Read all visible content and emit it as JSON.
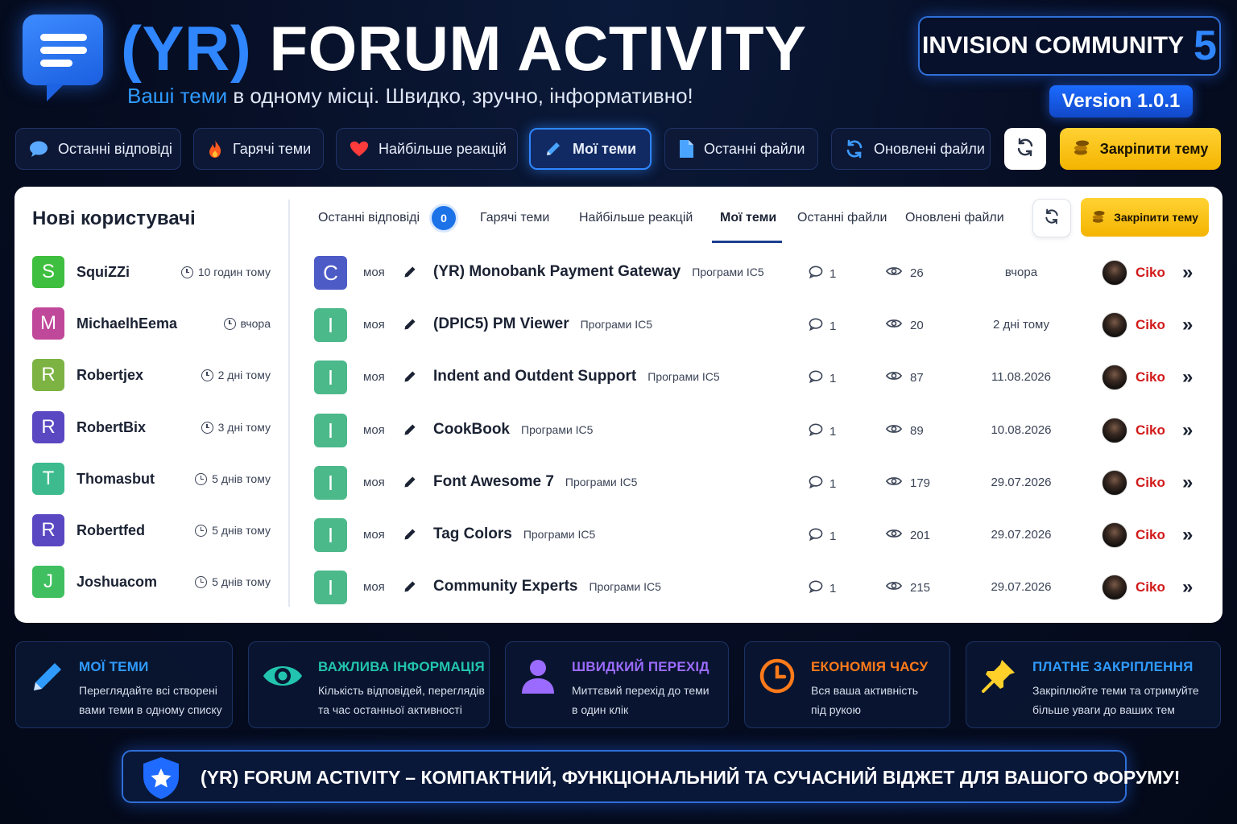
{
  "header": {
    "title_accent": "(YR)",
    "title_main": "FORUM ACTIVITY",
    "subtitle_accent": "Ваші теми",
    "subtitle_rest": "в одному місці. Швидко, зручно, інформативно!",
    "platform": "INVISION COMMUNITY",
    "platform_version": "5",
    "version": "Version 1.0.1"
  },
  "top_tabs": [
    {
      "label": "Останні відповіді",
      "icon": "speech-bubble-icon"
    },
    {
      "label": "Гарячі теми",
      "icon": "fire-icon"
    },
    {
      "label": "Найбільше реакцій",
      "icon": "heart-icon"
    },
    {
      "label": "Мої теми",
      "icon": "pencil-icon",
      "active": true
    },
    {
      "label": "Останні файли",
      "icon": "file-icon"
    },
    {
      "label": "Оновлені файли",
      "icon": "sync-icon"
    }
  ],
  "pin_label": "Закріпити тему",
  "sidebar": {
    "title": "Нові користувачі",
    "users": [
      {
        "initial": "S",
        "name": "SquiZZi",
        "time": "10 годин тому",
        "color": "#3fbf3f"
      },
      {
        "initial": "M",
        "name": "MichaelhEema",
        "time": "вчора",
        "color": "#c0489a"
      },
      {
        "initial": "R",
        "name": "Robertjex",
        "time": "2 дні тому",
        "color": "#7cb342"
      },
      {
        "initial": "R",
        "name": "RobertBix",
        "time": "3 дні тому",
        "color": "#5a47c2"
      },
      {
        "initial": "T",
        "name": "Thomasbut",
        "time": "5 днів тому",
        "color": "#3dbb8e"
      },
      {
        "initial": "R",
        "name": "Robertfed",
        "time": "5 днів тому",
        "color": "#5a47c2"
      },
      {
        "initial": "J",
        "name": "Joshuacom",
        "time": "5 днів тому",
        "color": "#3fbf5f"
      }
    ]
  },
  "inner_tabs": {
    "items": [
      "Останні відповіді",
      "Гарячі теми",
      "Найбільше реакцій",
      "Мої теми",
      "Останні файли",
      "Оновлені файли"
    ],
    "active_index": 3,
    "new_count": "0"
  },
  "topics": [
    {
      "initial": "C",
      "color": "#4d5bc7",
      "mine": "моя",
      "title": "(YR) Monobank Payment Gateway",
      "category": "Програми IC5",
      "replies": "1",
      "views": "26",
      "date": "вчора",
      "author": "Ciko"
    },
    {
      "initial": "I",
      "color": "#4cb98a",
      "mine": "моя",
      "title": "(DPIC5) PM Viewer",
      "category": "Програми IC5",
      "replies": "1",
      "views": "20",
      "date": "2 дні тому",
      "author": "Ciko"
    },
    {
      "initial": "I",
      "color": "#4cb98a",
      "mine": "моя",
      "title": "Indent and Outdent Support",
      "category": "Програми IC5",
      "replies": "1",
      "views": "87",
      "date": "11.08.2026",
      "author": "Ciko"
    },
    {
      "initial": "I",
      "color": "#4cb98a",
      "mine": "моя",
      "title": "CookBook",
      "category": "Програми IC5",
      "replies": "1",
      "views": "89",
      "date": "10.08.2026",
      "author": "Ciko"
    },
    {
      "initial": "I",
      "color": "#4cb98a",
      "mine": "моя",
      "title": "Font Awesome 7",
      "category": "Програми IC5",
      "replies": "1",
      "views": "179",
      "date": "29.07.2026",
      "author": "Ciko"
    },
    {
      "initial": "I",
      "color": "#4cb98a",
      "mine": "моя",
      "title": "Tag Colors",
      "category": "Програми IC5",
      "replies": "1",
      "views": "201",
      "date": "29.07.2026",
      "author": "Ciko"
    },
    {
      "initial": "I",
      "color": "#4cb98a",
      "mine": "моя",
      "title": "Community Experts",
      "category": "Програми IC5",
      "replies": "1",
      "views": "215",
      "date": "29.07.2026",
      "author": "Ciko"
    }
  ],
  "features": [
    {
      "title": "МОЇ ТЕМИ",
      "line1": "Переглядайте всі створені",
      "line2": "вами теми в одному списку",
      "color": "#2f9bff",
      "icon": "pencil-icon"
    },
    {
      "title": "ВАЖЛИВА ІНФОРМАЦІЯ",
      "line1": "Кількість відповідей, переглядів",
      "line2": "та час останньої активності",
      "color": "#22c4b0",
      "icon": "eye-icon"
    },
    {
      "title": "ШВИДКИЙ ПЕРЕХІД",
      "line1": "Миттєвий перехід до теми",
      "line2": "в один клік",
      "color": "#9b6bff",
      "icon": "user-icon"
    },
    {
      "title": "ЕКОНОМІЯ ЧАСУ",
      "line1": "Вся ваша активність",
      "line2": "під рукою",
      "color": "#ff7a1a",
      "icon": "clock-icon"
    },
    {
      "title": "ПЛАТНЕ ЗАКРІПЛЕННЯ",
      "line1": "Закріплюйте теми та отримуйте",
      "line2": "більше уваги до ваших тем",
      "color": "#2f9bff",
      "icon": "pushpin-icon"
    }
  ],
  "banner": "(YR) FORUM ACTIVITY – КОМПАКТНИЙ, ФУНКЦІОНАЛЬНИЙ ТА СУЧАСНИЙ ВІДЖЕТ ДЛЯ ВАШОГО ФОРУМУ!"
}
